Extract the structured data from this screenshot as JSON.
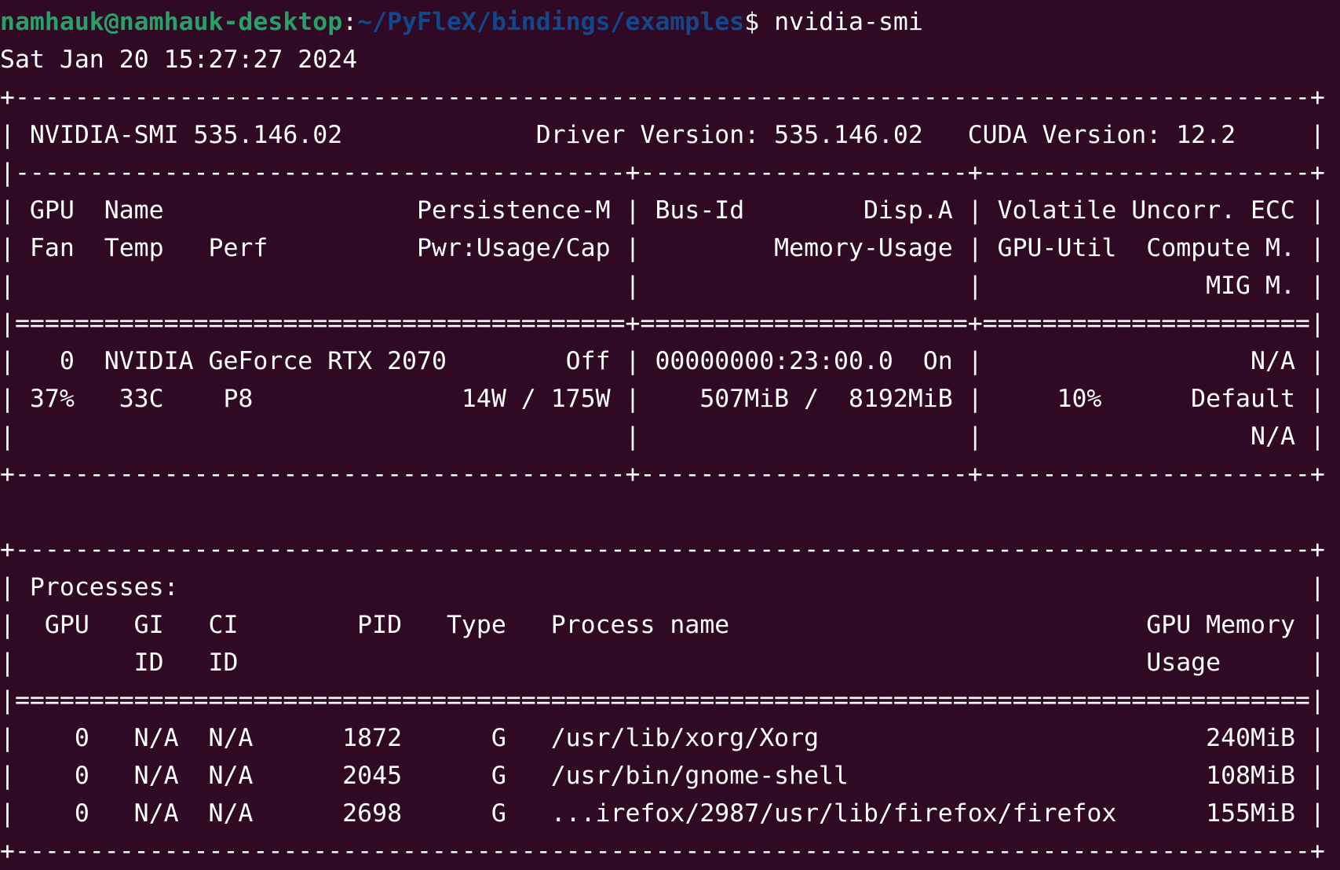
{
  "prompt": {
    "user_host": "namhauk@namhauk-desktop",
    "separator": ":",
    "path": "~/PyFleX/bindings/examples",
    "symbol": "$ ",
    "command": "nvidia-smi"
  },
  "colors": {
    "background": "#300a24",
    "text": "#ffffff",
    "user_host": "#26a269",
    "path": "#12488b"
  },
  "output_lines": [
    "Sat Jan 20 15:27:27 2024",
    "+---------------------------------------------------------------------------------------+",
    "| NVIDIA-SMI 535.146.02             Driver Version: 535.146.02   CUDA Version: 12.2     |",
    "|-----------------------------------------+----------------------+----------------------+",
    "| GPU  Name                 Persistence-M | Bus-Id        Disp.A | Volatile Uncorr. ECC |",
    "| Fan  Temp   Perf          Pwr:Usage/Cap |         Memory-Usage | GPU-Util  Compute M. |",
    "|                                         |                      |               MIG M. |",
    "|=========================================+======================+======================|",
    "|   0  NVIDIA GeForce RTX 2070        Off | 00000000:23:00.0  On |                  N/A |",
    "| 37%   33C    P8              14W / 175W |    507MiB /  8192MiB |     10%      Default |",
    "|                                         |                      |                  N/A |",
    "+-----------------------------------------+----------------------+----------------------+",
    "",
    "+---------------------------------------------------------------------------------------+",
    "| Processes:                                                                            |",
    "|  GPU   GI   CI        PID   Type   Process name                            GPU Memory |",
    "|        ID   ID                                                             Usage      |",
    "|=======================================================================================|",
    "|    0   N/A  N/A      1872      G   /usr/lib/xorg/Xorg                          240MiB |",
    "|    0   N/A  N/A      2045      G   /usr/bin/gnome-shell                        108MiB |",
    "|    0   N/A  N/A      2698      G   ...irefox/2987/usr/lib/firefox/firefox      155MiB |",
    "+---------------------------------------------------------------------------------------+"
  ]
}
